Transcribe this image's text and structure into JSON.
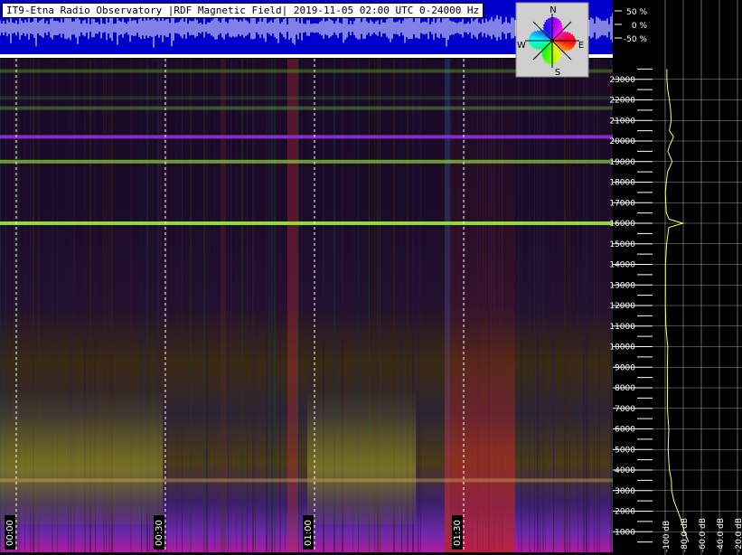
{
  "title": "IT9-Etna Radio Observatory |RDF Magnetic Field| 2019-11-05 02:00 UTC 0-24000 Hz",
  "compass": {
    "n": "N",
    "s": "S",
    "e": "E",
    "w": "W"
  },
  "amplitude_scale": [
    "50 %",
    "0 %",
    "-50 %"
  ],
  "colors": {
    "waveform_bg": "#0000cc",
    "waveform": "#ffffff",
    "spectrum_line": "#ffff66",
    "time_marker": "#ffffff"
  },
  "chart_data": {
    "type": "heatmap",
    "title": "IT9-Etna Radio Observatory |RDF Magnetic Field| 2019-11-05 02:00 UTC 0-24000 Hz",
    "x_tick_labels": [
      "00:00",
      "00:30",
      "01:00",
      "01:30"
    ],
    "y_tick_labels": [
      23000,
      22000,
      21000,
      20000,
      19000,
      18000,
      17000,
      16000,
      15000,
      14000,
      13000,
      12000,
      11000,
      10000,
      9000,
      8000,
      7000,
      6000,
      5000,
      4000,
      3000,
      2000,
      1000
    ],
    "ylim": [
      0,
      24000
    ],
    "spectrum_axis": {
      "tick_labels": [
        "-100 dB",
        "-80.0 dB",
        "-60.0 dB",
        "-40.0 dB",
        "-20.0 dB"
      ],
      "xlim": [
        -100,
        -20
      ]
    },
    "spectrum_profile": [
      [
        23500,
        -98
      ],
      [
        23000,
        -98
      ],
      [
        22500,
        -97
      ],
      [
        22000,
        -96
      ],
      [
        21500,
        -95
      ],
      [
        21000,
        -94
      ],
      [
        20500,
        -95
      ],
      [
        20200,
        -90
      ],
      [
        19800,
        -96
      ],
      [
        19500,
        -97
      ],
      [
        19000,
        -92
      ],
      [
        18500,
        -97
      ],
      [
        18000,
        -99
      ],
      [
        17500,
        -99
      ],
      [
        17000,
        -99
      ],
      [
        16500,
        -98
      ],
      [
        16200,
        -96
      ],
      [
        16000,
        -80
      ],
      [
        15800,
        -96
      ],
      [
        15500,
        -97
      ],
      [
        15000,
        -99
      ],
      [
        14000,
        -99
      ],
      [
        13000,
        -99
      ],
      [
        12000,
        -99
      ],
      [
        11000,
        -99
      ],
      [
        10000,
        -98
      ],
      [
        9000,
        -98
      ],
      [
        8000,
        -98
      ],
      [
        7000,
        -97
      ],
      [
        6000,
        -97
      ],
      [
        5000,
        -97
      ],
      [
        4500,
        -96
      ],
      [
        4000,
        -95
      ],
      [
        3500,
        -93
      ],
      [
        3000,
        -92
      ],
      [
        2500,
        -90
      ],
      [
        2000,
        -86
      ],
      [
        1500,
        -82
      ],
      [
        1000,
        -78
      ],
      [
        500,
        -74
      ]
    ],
    "bright_bands": [
      {
        "freq": 23400,
        "strength": 0.55,
        "color": "#4f8a22"
      },
      {
        "freq": 22100,
        "strength": 0.35,
        "color": "#3e6d2a"
      },
      {
        "freq": 21600,
        "strength": 0.55,
        "color": "#4e8f3c"
      },
      {
        "freq": 20200,
        "strength": 0.9,
        "color": "#8f2fe0"
      },
      {
        "freq": 19000,
        "strength": 0.8,
        "color": "#7fbf30"
      },
      {
        "freq": 16000,
        "strength": 1.0,
        "color": "#8fdc2a"
      },
      {
        "freq": 3500,
        "strength": 0.45,
        "color": "#c9a64d"
      }
    ]
  }
}
